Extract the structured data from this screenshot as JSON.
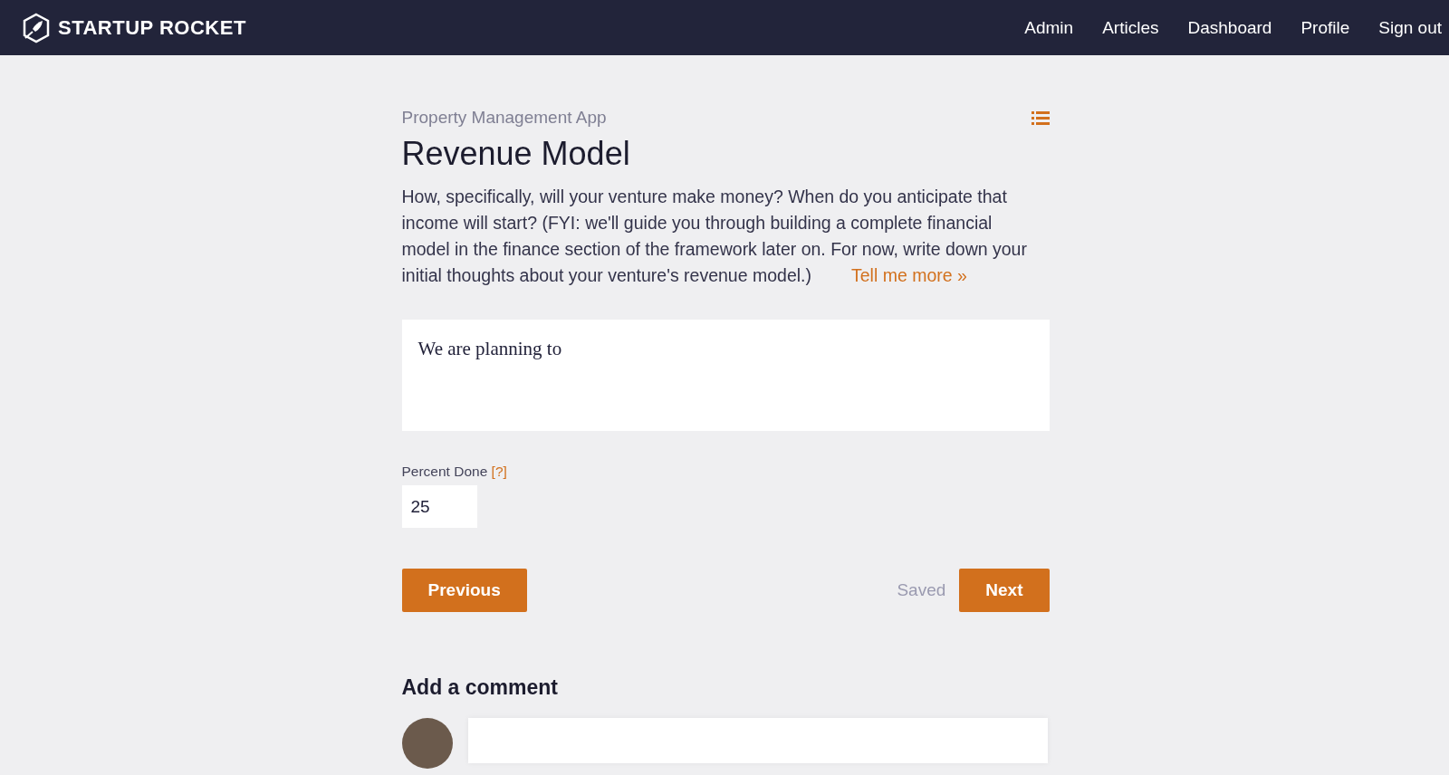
{
  "navbar": {
    "brand": "STARTUP ROCKET",
    "links": [
      "Admin",
      "Articles",
      "Dashboard",
      "Profile",
      "Sign out"
    ]
  },
  "section": {
    "project": "Property Management App",
    "title": "Revenue Model",
    "description": "How, specifically, will your venture make money? When do you anticipate that income will start? (FYI: we'll guide you through building a complete financial model in the finance section of the framework later on. For now, write down your initial thoughts about your venture's revenue model.)",
    "more_link": "Tell me more  »"
  },
  "answer": {
    "value": "We are planning to"
  },
  "percent_done": {
    "label": "Percent Done",
    "help": "[?]",
    "value": "25"
  },
  "actions": {
    "previous": "Previous",
    "status": "Saved",
    "next": "Next"
  },
  "comments": {
    "heading": "Add a comment"
  }
}
